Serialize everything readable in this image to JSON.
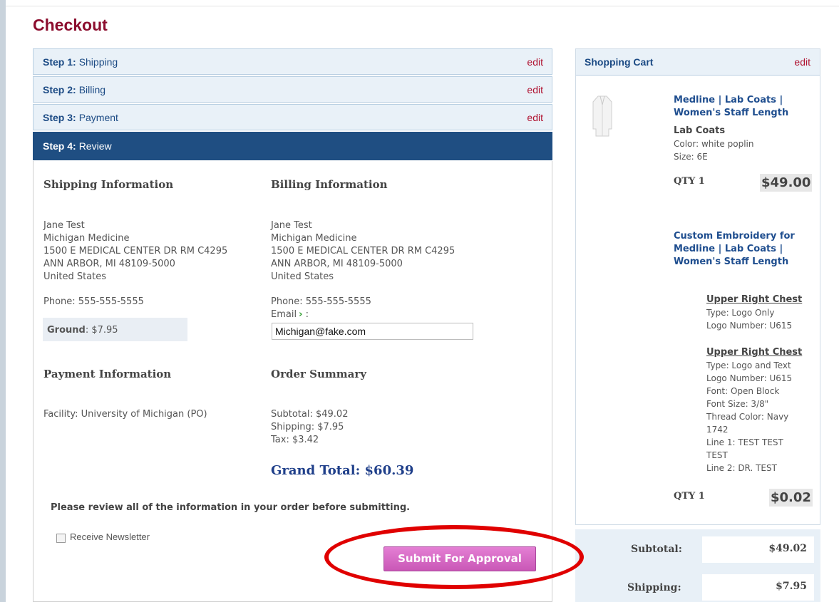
{
  "page": {
    "title": "Checkout"
  },
  "steps": [
    {
      "num": "Step 1:",
      "label": "Shipping",
      "edit": "edit"
    },
    {
      "num": "Step 2:",
      "label": "Billing",
      "edit": "edit"
    },
    {
      "num": "Step 3:",
      "label": "Payment",
      "edit": "edit"
    },
    {
      "num": "Step 4:",
      "label": "Review"
    }
  ],
  "review": {
    "shipping": {
      "heading": "Shipping Information",
      "name": "Jane Test",
      "org": "Michigan Medicine",
      "street": "1500 E MEDICAL CENTER DR RM C4295",
      "city": "ANN ARBOR, MI 48109-5000",
      "country": "United States",
      "phone": "Phone: 555-555-5555",
      "method_label": "Ground",
      "method_price": ": $7.95"
    },
    "billing": {
      "heading": "Billing Information",
      "name": "Jane Test",
      "org": "Michigan Medicine",
      "street": "1500 E MEDICAL CENTER DR RM C4295",
      "city": "ANN ARBOR, MI 48109-5000",
      "country": "United States",
      "phone": "Phone: 555-555-5555",
      "email_label": "Email",
      "email_arrow": "›",
      "email_colon": ":",
      "email_value": "Michigan@fake.com"
    },
    "payment": {
      "heading": "Payment Information",
      "facility": "Facility: University of Michigan (PO)"
    },
    "summary": {
      "heading": "Order Summary",
      "subtotal": "Subtotal: $49.02",
      "shipping": "Shipping: $7.95",
      "tax": "Tax: $3.42",
      "grand_total": "Grand Total: $60.39"
    },
    "notice": "Please review all of the information in your order before submitting.",
    "newsletter_label": "Receive Newsletter",
    "submit_label": "Submit For Approval"
  },
  "cart": {
    "title": "Shopping Cart",
    "edit": "edit",
    "item1": {
      "name_line1": "Medline | Lab Coats |",
      "name_line2": "Women's Staff Length",
      "category": "Lab Coats",
      "color": "Color: white poplin",
      "size": "Size: 6E",
      "qty": "QTY 1",
      "price": "$49.00"
    },
    "item2": {
      "name_line1": "Custom Embroidery for",
      "name_line2": "Medline | Lab Coats |",
      "name_line3": "Women's Staff Length",
      "loc1": "Upper Right Chest",
      "loc1_type": "Type: Logo Only",
      "loc1_logo": "Logo Number: U615",
      "loc2": "Upper Right Chest",
      "loc2_type": "Type: Logo and Text",
      "loc2_logo": "Logo Number: U615",
      "loc2_font": "Font: Open Block",
      "loc2_fontsize": "Font Size: 3/8\"",
      "loc2_thread": "Thread Color: Navy",
      "loc2_thread2": "1742",
      "loc2_line1a": "Line 1: TEST TEST",
      "loc2_line1b": "TEST",
      "loc2_line2": "Line 2: DR. TEST",
      "qty": "QTY 1",
      "price": "$0.02"
    }
  },
  "totals": {
    "subtotal_label": "Subtotal:",
    "subtotal_value": "$49.02",
    "shipping_label": "Shipping:",
    "shipping_value": "$7.95"
  },
  "colors": {
    "brand": "#8c0d2e",
    "active_step": "#1f4e82",
    "link_blue": "#1f4e8f",
    "submit": "#c957b6",
    "highlight": "#e00000"
  },
  "icons": [
    "lab-coat-thumbnail",
    "chevron-right-icon"
  ]
}
